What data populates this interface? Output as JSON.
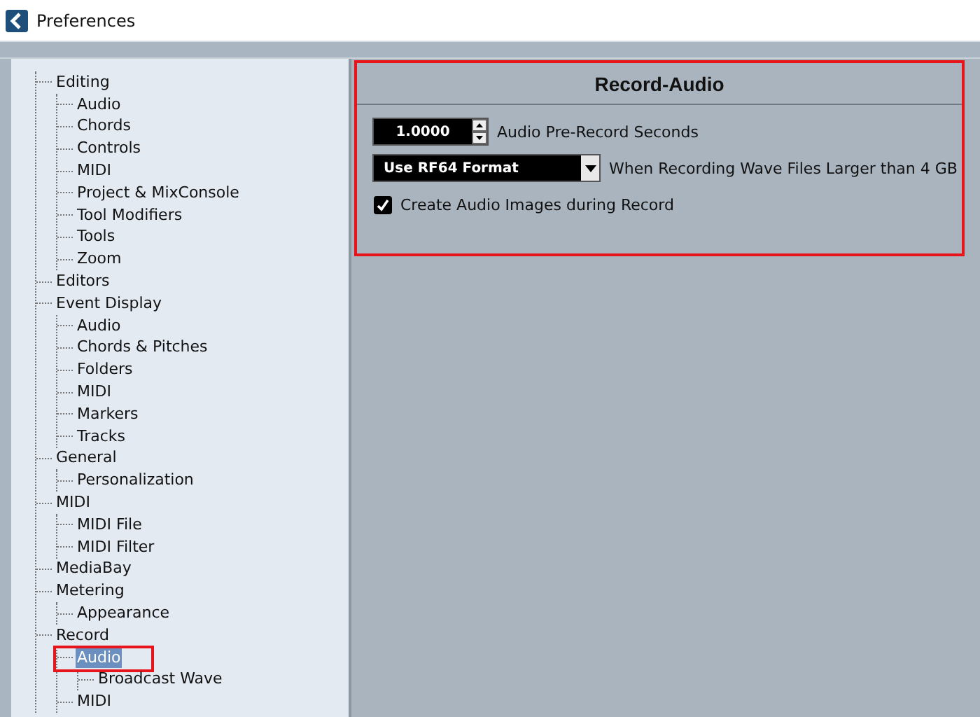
{
  "window": {
    "title": "Preferences"
  },
  "tree": [
    {
      "label": "Editing",
      "selected": false,
      "children": [
        {
          "label": "Audio",
          "selected": false
        },
        {
          "label": "Chords",
          "selected": false
        },
        {
          "label": "Controls",
          "selected": false
        },
        {
          "label": "MIDI",
          "selected": false
        },
        {
          "label": "Project & MixConsole",
          "selected": false
        },
        {
          "label": "Tool Modifiers",
          "selected": false
        },
        {
          "label": "Tools",
          "selected": false
        },
        {
          "label": "Zoom",
          "selected": false
        }
      ]
    },
    {
      "label": "Editors",
      "selected": false
    },
    {
      "label": "Event Display",
      "selected": false,
      "children": [
        {
          "label": "Audio",
          "selected": false
        },
        {
          "label": "Chords & Pitches",
          "selected": false
        },
        {
          "label": "Folders",
          "selected": false
        },
        {
          "label": "MIDI",
          "selected": false
        },
        {
          "label": "Markers",
          "selected": false
        },
        {
          "label": "Tracks",
          "selected": false
        }
      ]
    },
    {
      "label": "General",
      "selected": false,
      "children": [
        {
          "label": "Personalization",
          "selected": false
        }
      ]
    },
    {
      "label": "MIDI",
      "selected": false,
      "children": [
        {
          "label": "MIDI File",
          "selected": false
        },
        {
          "label": "MIDI Filter",
          "selected": false
        }
      ]
    },
    {
      "label": "MediaBay",
      "selected": false
    },
    {
      "label": "Metering",
      "selected": false,
      "children": [
        {
          "label": "Appearance",
          "selected": false
        }
      ]
    },
    {
      "label": "Record",
      "selected": false,
      "children": [
        {
          "label": "Audio",
          "selected": true,
          "children": [
            {
              "label": "Broadcast Wave",
              "selected": false
            }
          ]
        },
        {
          "label": "MIDI",
          "selected": false
        }
      ]
    }
  ],
  "panel": {
    "title": "Record-Audio",
    "settings": [
      {
        "kind": "spinner",
        "value": "1.0000",
        "caption": "Audio Pre-Record Seconds"
      },
      {
        "kind": "dropdown",
        "value": "Use RF64 Format",
        "caption": "When Recording Wave Files Larger than 4 GB"
      },
      {
        "kind": "checkbox",
        "checked": true,
        "caption": "Create Audio Images during Record"
      }
    ]
  }
}
